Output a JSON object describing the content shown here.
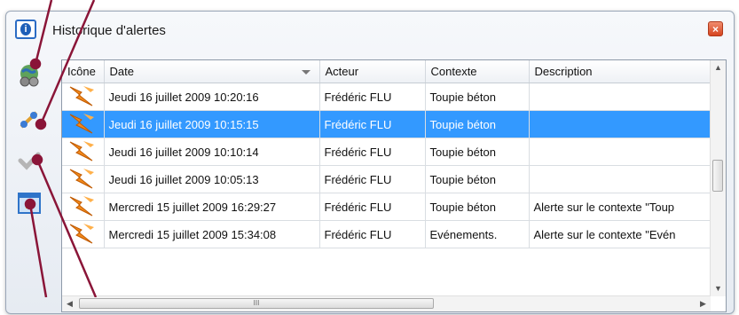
{
  "window": {
    "title": "Historique d'alertes",
    "close_label": "×"
  },
  "toolbar": [
    "globe-settings",
    "link-edit",
    "check-gray",
    "window-plus"
  ],
  "grid": {
    "columns": [
      "Icône",
      "Date",
      "Acteur",
      "Contexte",
      "Description"
    ],
    "sorted_column": "Date",
    "selected_row": 1,
    "rows": [
      {
        "date": "Jeudi 16 juillet 2009 10:20:16",
        "actor": "Frédéric FLU",
        "context": "Toupie béton",
        "description": ""
      },
      {
        "date": "Jeudi 16 juillet 2009 10:15:15",
        "actor": "Frédéric FLU",
        "context": "Toupie béton",
        "description": ""
      },
      {
        "date": "Jeudi 16 juillet 2009 10:10:14",
        "actor": "Frédéric FLU",
        "context": "Toupie béton",
        "description": ""
      },
      {
        "date": "Jeudi 16 juillet 2009 10:05:13",
        "actor": "Frédéric FLU",
        "context": "Toupie béton",
        "description": ""
      },
      {
        "date": "Mercredi 15 juillet 2009 16:29:27",
        "actor": "Frédéric FLU",
        "context": "Toupie béton",
        "description": "Alerte sur le contexte \"Toup"
      },
      {
        "date": "Mercredi 15 juillet 2009 15:34:08",
        "actor": "Frédéric FLU",
        "context": "Evénements.",
        "description": "Alerte sur le contexte \"Evén"
      }
    ],
    "hscroll_grip": "III"
  },
  "colors": {
    "selection": "#3399ff",
    "callout": "#8a1538",
    "alert_orange": "#f28a1c"
  }
}
